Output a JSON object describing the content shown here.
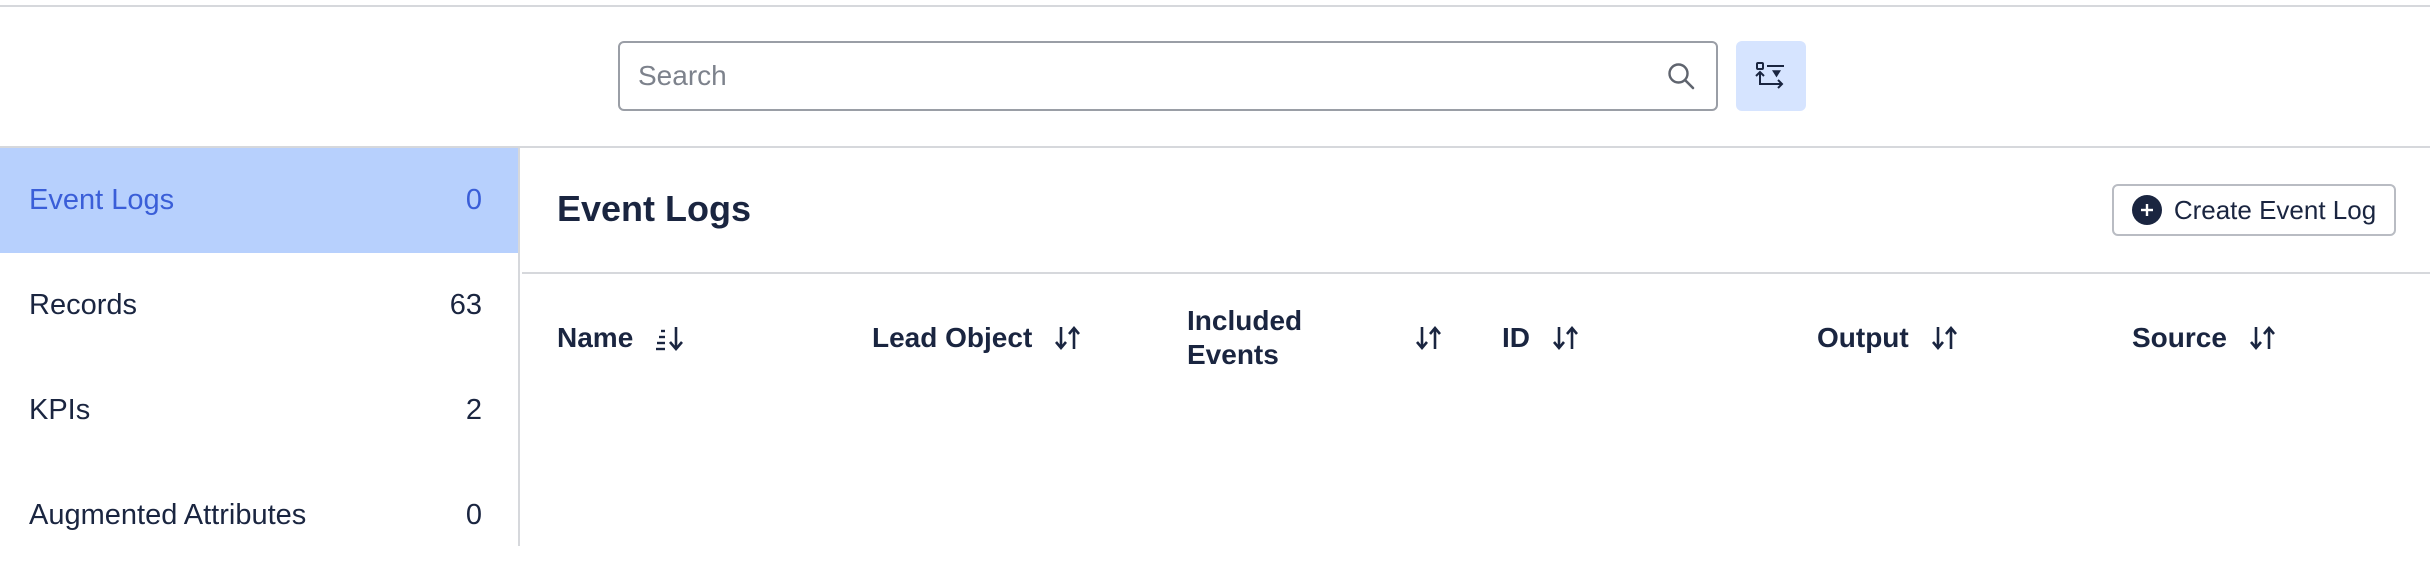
{
  "search": {
    "placeholder": "Search"
  },
  "sidebar": {
    "items": [
      {
        "label": "Event Logs",
        "count": "0"
      },
      {
        "label": "Records",
        "count": "63"
      },
      {
        "label": "KPIs",
        "count": "2"
      },
      {
        "label": "Augmented Attributes",
        "count": "0"
      }
    ]
  },
  "main": {
    "title": "Event Logs",
    "create_button": "Create Event Log",
    "columns": [
      {
        "label": "Name"
      },
      {
        "label": "Lead Object"
      },
      {
        "label": "Included Events"
      },
      {
        "label": "ID"
      },
      {
        "label": "Output"
      },
      {
        "label": "Source"
      }
    ]
  },
  "colors": {
    "accent": "#3a5ed8",
    "active_bg": "#b7d0fd",
    "filter_bg": "#d6e4ff",
    "text": "#1a2540"
  },
  "icons": {
    "search": "search-icon",
    "filter": "filter-toggle-icon",
    "create": "plus-circle-icon",
    "sort_active": "sort-descending-icon",
    "sort": "sort-icon"
  }
}
